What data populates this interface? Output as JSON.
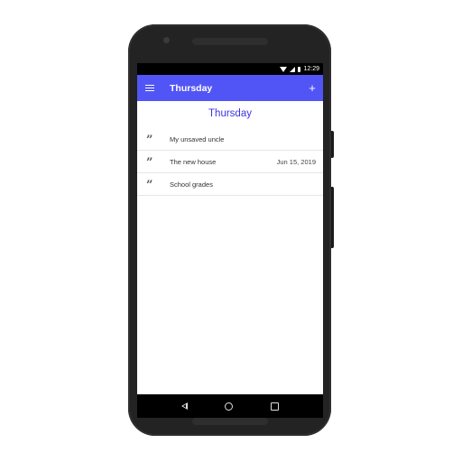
{
  "status_bar": {
    "time": "12:29",
    "icons": [
      "wifi-icon",
      "signal-icon",
      "battery-icon"
    ]
  },
  "app_bar": {
    "title": "Thursday",
    "menu_icon": "menu-icon",
    "add_icon": "add-icon",
    "add_symbol": "+",
    "color": "#5255f5"
  },
  "main": {
    "heading": "Thursday",
    "heading_color": "#3c34e4",
    "items": [
      {
        "icon": "quote-icon",
        "title": "My unsaved uncle",
        "date": ""
      },
      {
        "icon": "quote-icon",
        "title": "The new house",
        "date": "Jun 15, 2019"
      },
      {
        "icon": "quote-icon",
        "title": "School grades",
        "date": ""
      }
    ],
    "quote_glyph": "”"
  },
  "nav_bar": {
    "icons": [
      "back-icon",
      "home-icon",
      "recents-icon"
    ]
  }
}
